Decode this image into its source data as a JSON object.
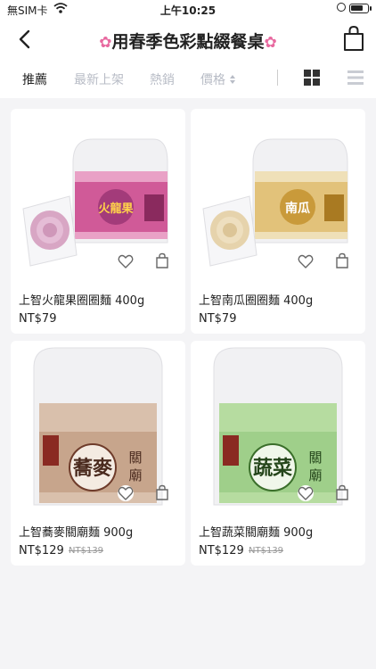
{
  "status_bar": {
    "carrier": "無SIM卡",
    "time": "上午10:25"
  },
  "header": {
    "title": "用春季色彩點綴餐桌",
    "title_icon": "cherry-blossom-icon"
  },
  "filters": {
    "tabs": [
      {
        "label": "推薦",
        "active": true
      },
      {
        "label": "最新上架",
        "active": false
      },
      {
        "label": "熱銷",
        "active": false
      },
      {
        "label": "價格",
        "active": false
      }
    ]
  },
  "products": [
    {
      "name": "上智火龍果圈圈麵 400g",
      "price": "NT$79",
      "original_price": "",
      "package_color": "#d05a98",
      "noodle_color": "#d8a6c4",
      "package_label": "火龍果"
    },
    {
      "name": "上智南瓜圈圈麵 400g",
      "price": "NT$79",
      "original_price": "",
      "package_color": "#e2c27a",
      "noodle_color": "#e6d3ac",
      "package_label": "南瓜"
    },
    {
      "name": "上智蕎麥關廟麵 900g",
      "price": "NT$129",
      "original_price": "NT$139",
      "package_color": "#c7a58c",
      "noodle_color": "#d9c0ac",
      "package_label": "蕎麥"
    },
    {
      "name": "上智蔬菜關廟麵 900g",
      "price": "NT$129",
      "original_price": "NT$139",
      "package_color": "#9fcf8a",
      "noodle_color": "#b6dca0",
      "package_label": "蔬菜"
    }
  ]
}
